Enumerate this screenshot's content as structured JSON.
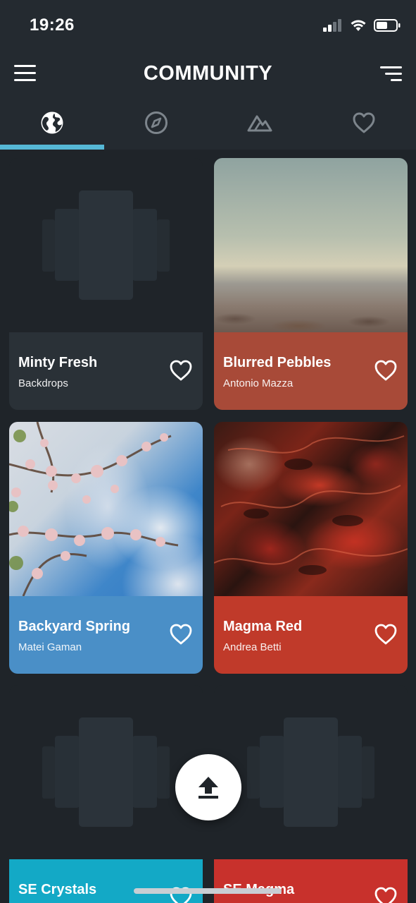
{
  "status_bar": {
    "time": "19:26"
  },
  "header": {
    "title": "COMMUNITY"
  },
  "tabs": [
    {
      "icon": "globe-icon",
      "active": true
    },
    {
      "icon": "compass-icon",
      "active": false
    },
    {
      "icon": "mountain-icon",
      "active": false
    },
    {
      "icon": "heart-icon",
      "active": false
    }
  ],
  "cards": [
    {
      "title": "Minty Fresh",
      "author": "Backdrops",
      "color": "#2a3137",
      "image": "placeholder"
    },
    {
      "title": "Blurred Pebbles",
      "author": "Antonio Mazza",
      "color": "#a84a38",
      "image": "pebbles"
    },
    {
      "title": "Backyard Spring",
      "author": "Matei Gaman",
      "color": "#4a8fc7",
      "image": "blossom"
    },
    {
      "title": "Magma Red",
      "author": "Andrea Betti",
      "color": "#c03a2a",
      "image": "magma"
    },
    {
      "title": "SE Crystals",
      "author": "",
      "color": "#13a9c6",
      "image": "placeholder"
    },
    {
      "title": "SE Magma",
      "author": "",
      "color": "#c8312c",
      "image": "placeholder"
    }
  ],
  "colors": {
    "accent": "#56b8d6",
    "background": "#1f2429",
    "header": "#242a30"
  }
}
